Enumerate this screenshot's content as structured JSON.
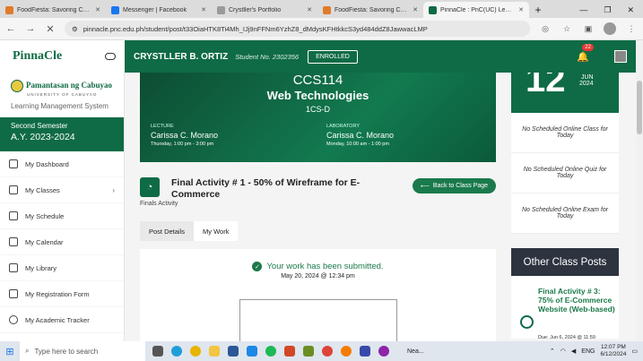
{
  "browser": {
    "tabs": [
      {
        "title": "FoodFiesta: Savoring Culina",
        "icon_color": "#e07b2a",
        "active": false
      },
      {
        "title": "Messenger | Facebook",
        "icon_color": "#1877f2",
        "active": false
      },
      {
        "title": "Crystller's Portfolio",
        "icon_color": "#9a9a9a",
        "active": false
      },
      {
        "title": "FoodFiesta: Savoring Culina",
        "icon_color": "#e07b2a",
        "active": false
      },
      {
        "title": "PinnaCle : PnC(UC) Learning",
        "icon_color": "#0f6b45",
        "active": true
      }
    ],
    "new_tab": "+",
    "url": "pinnacle.pnc.edu.ph/student/post/t33OiaHTK8Ti4Mh_IJj9nFFNm6YzhZ8_dMdysKFHtkkcS3yd484ddZ8JawwacLMP"
  },
  "app": {
    "brand": "PinnaCle",
    "student_name": "CRYSTLLER B. ORTIZ",
    "student_no": "Student No. 2302356",
    "status": "ENROLLED",
    "notif_count": "22"
  },
  "sidebar": {
    "school_name": "Pamantasan ng Cabuyao",
    "school_sub": "UNIVERSITY OF CABUYAO",
    "lms": "Learning Management System",
    "semester": "Second Semester",
    "year": "A.Y. 2023-2024",
    "items": [
      {
        "label": "My Dashboard"
      },
      {
        "label": "My Classes"
      },
      {
        "label": "My Schedule"
      },
      {
        "label": "My Calendar"
      },
      {
        "label": "My Library"
      },
      {
        "label": "My Registration Form"
      },
      {
        "label": "My Academic Tracker"
      }
    ]
  },
  "course": {
    "code": "CCS114",
    "title": "Web Technologies",
    "section": "1CS-D",
    "lecture_label": "LECTURE",
    "lecture_prof": "Carissa C. Morano",
    "lecture_time": "Thursday, 1:00 pm - 3:00 pm",
    "lab_label": "LABORATORY",
    "lab_prof": "Carissa C. Morano",
    "lab_time": "Monday, 10:00 am - 1:00 pm"
  },
  "activity": {
    "title": "Final Activity # 1 - 50% of Wireframe for E-Commerce",
    "category": "Finals Activity",
    "back_label": "Back to Class Page",
    "tabs": [
      "Post Details",
      "My Work"
    ],
    "submitted": "Your work has been submitted.",
    "submitted_date": "May 20, 2024 @ 12:34 pm"
  },
  "right": {
    "day": "12",
    "month": "JUN",
    "year": "2024",
    "notes": [
      "No Scheduled Online Class for Today",
      "No Scheduled Online Quiz for Today",
      "No Scheduled Online Exam for Today"
    ],
    "other_title": "Other Class Posts",
    "post_title": "Final Activity # 3: 75% of E-Commerce Website (Web-based)",
    "post_due": "Due: Jun 6, 2024 @ 11:59"
  },
  "taskbar": {
    "search": "Type here to search",
    "weather": "Nea...",
    "lang": "ENG",
    "time": "12:07 PM",
    "date": "6/12/2024"
  }
}
